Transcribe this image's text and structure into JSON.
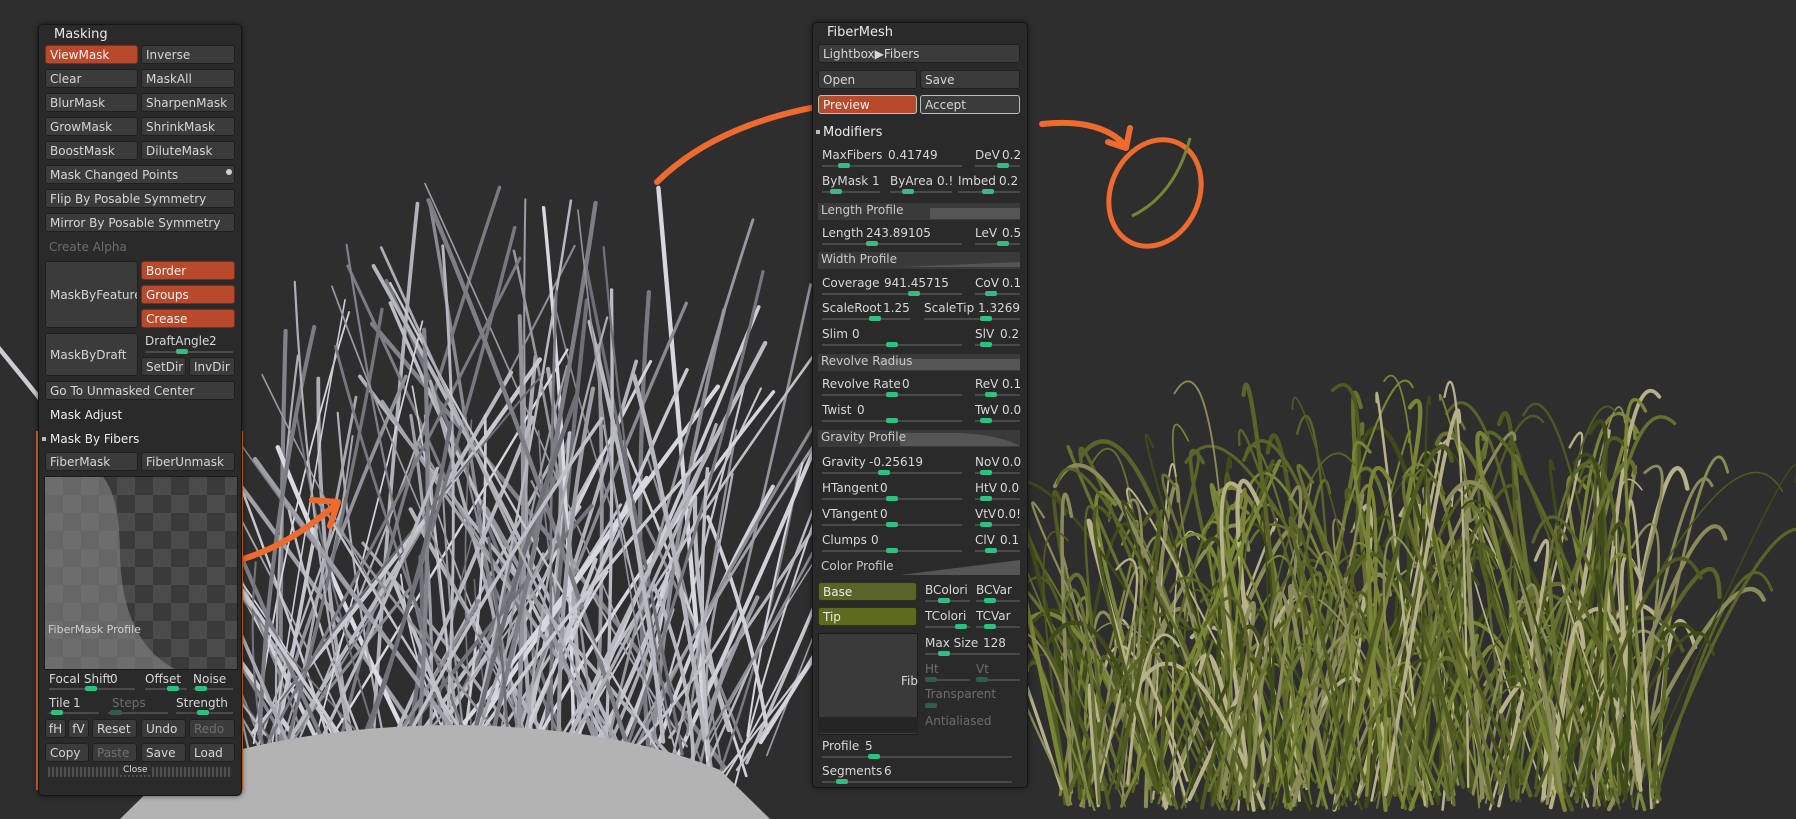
{
  "masking": {
    "title": "Masking",
    "view_mask": "ViewMask",
    "inverse": "Inverse",
    "clear": "Clear",
    "mask_all": "MaskAll",
    "blur_mask": "BlurMask",
    "sharpen_mask": "SharpenMask",
    "grow_mask": "GrowMask",
    "shrink_mask": "ShrinkMask",
    "boost_mask": "BoostMask",
    "dilute_mask": "DiluteMask",
    "mask_changed_points": "Mask Changed Points",
    "flip_by_posable": "Flip By Posable Symmetry",
    "mirror_by_posable": "Mirror By Posable Symmetry",
    "create_alpha": "Create Alpha",
    "mask_by_feature": "MaskByFeature",
    "border": "Border",
    "groups": "Groups",
    "crease": "Crease",
    "mask_by_draft": "MaskByDraft",
    "draft_angle": "DraftAngle",
    "draft_angle_value": "2",
    "set_dir": "SetDir",
    "inv_dir": "InvDir",
    "go_to_unmasked": "Go To Unmasked Center",
    "mask_adjust": "Mask Adjust",
    "mask_by_fibers": "Mask By Fibers",
    "fiber_mask": "FiberMask",
    "fiber_unmask": "FiberUnmask",
    "profile_label": "FiberMask Profile",
    "focal_shift": "Focal Shift",
    "focal_shift_value": "0",
    "offset": "Offset",
    "noise": "Noise",
    "tile": "Tile",
    "tile_value": "1",
    "steps": "Steps",
    "strength": "Strength",
    "fh": "fH",
    "fv": "fV",
    "reset": "Reset",
    "undo": "Undo",
    "redo": "Redo",
    "copy": "Copy",
    "paste": "Paste",
    "save": "Save",
    "load": "Load",
    "close": "Close"
  },
  "fibermesh": {
    "title": "FiberMesh",
    "lightbox": "Lightbox▶Fibers",
    "open": "Open",
    "save": "Save",
    "preview": "Preview",
    "accept": "Accept",
    "modifiers": "Modifiers",
    "max_fibers": "MaxFibers",
    "max_fibers_value": "0.41749",
    "dev": "DeV",
    "dev_value": "0.2",
    "by_mask": "ByMask",
    "by_mask_value": "1",
    "by_area": "ByArea",
    "by_area_value": "0.!",
    "imbed": "Imbed",
    "imbed_value": "0.2",
    "length_profile": "Length Profile",
    "length": "Length",
    "length_value": "243.89105",
    "lev": "LeV",
    "lev_value": "0.5",
    "width_profile": "Width Profile",
    "coverage": "Coverage",
    "coverage_value": "941.45715",
    "cov": "CoV",
    "cov_value": "0.1",
    "scale_root": "ScaleRoot",
    "scale_root_value": "1.25",
    "scale_tip": "ScaleTip",
    "scale_tip_value": "1.3269",
    "slim": "Slim",
    "slim_value": "0",
    "siv": "SlV",
    "siv_value": "0.2",
    "revolve_radius": "Revolve Radius",
    "revolve_rate": "Revolve Rate",
    "revolve_rate_value": "0",
    "rev": "ReV",
    "rev_value": "0.1",
    "twist": "Twist",
    "twist_value": "0",
    "twv": "TwV",
    "twv_value": "0.0",
    "gravity_profile": "Gravity Profile",
    "gravity": "Gravity",
    "gravity_value": "-0.25619",
    "nov": "NoV",
    "nov_value": "0.0",
    "htangent": "HTangent",
    "htangent_value": "0",
    "htv": "HtV",
    "htv_value": "0.0",
    "vtangent": "VTangent",
    "vtangent_value": "0",
    "vtv": "VtV",
    "vtv_value": "0.0!",
    "clumps": "Clumps",
    "clumps_value": "0",
    "clv": "ClV",
    "clv_value": "0.1",
    "color_profile": "Color Profile",
    "base": "Base",
    "tip": "Tip",
    "bcolori": "BColori",
    "bcvar": "BCVar",
    "tcolori": "TColori",
    "tcvar": "TCVar",
    "fib": "Fib",
    "max_size": "Max Size",
    "max_size_value": "128",
    "ht": "Ht",
    "vt": "Vt",
    "transparent": "Transparent",
    "antialiased": "Antialiased",
    "profile": "Profile",
    "profile_value": "5",
    "segments": "Segments",
    "segments_value": "6"
  },
  "colors": {
    "accent_orange": "#b8492b",
    "annotation_orange": "#ee6a2e",
    "olive": "#5a6428",
    "slider_green": "#2fbf7f",
    "canvas": "#2e2e2e"
  }
}
